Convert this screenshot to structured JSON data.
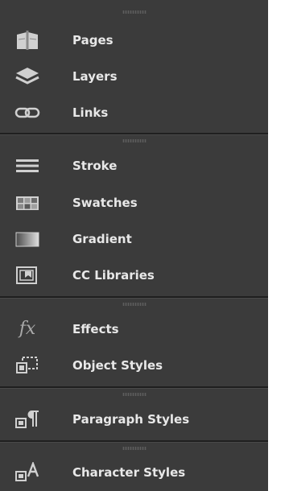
{
  "panels": [
    {
      "id": "pages",
      "label": "Pages",
      "icon": "pages-icon"
    },
    {
      "id": "layers",
      "label": "Layers",
      "icon": "layers-icon"
    },
    {
      "id": "links",
      "label": "Links",
      "icon": "links-icon"
    },
    {
      "id": "stroke",
      "label": "Stroke",
      "icon": "stroke-icon"
    },
    {
      "id": "swatches",
      "label": "Swatches",
      "icon": "swatches-icon"
    },
    {
      "id": "gradient",
      "label": "Gradient",
      "icon": "gradient-icon"
    },
    {
      "id": "cc-libraries",
      "label": "CC Libraries",
      "icon": "cc-libraries-icon"
    },
    {
      "id": "effects",
      "label": "Effects",
      "icon": "fx-icon",
      "glyph": "fx"
    },
    {
      "id": "object-styles",
      "label": "Object Styles",
      "icon": "object-styles-icon"
    },
    {
      "id": "paragraph-styles",
      "label": "Paragraph Styles",
      "icon": "paragraph-styles-icon"
    },
    {
      "id": "character-styles",
      "label": "Character Styles",
      "icon": "character-styles-icon"
    }
  ],
  "colors": {
    "panel_bg": "#3b3b3b",
    "text": "#e8e8e8",
    "icon": "#c8c8c8",
    "divider": "#1f1f1f"
  }
}
